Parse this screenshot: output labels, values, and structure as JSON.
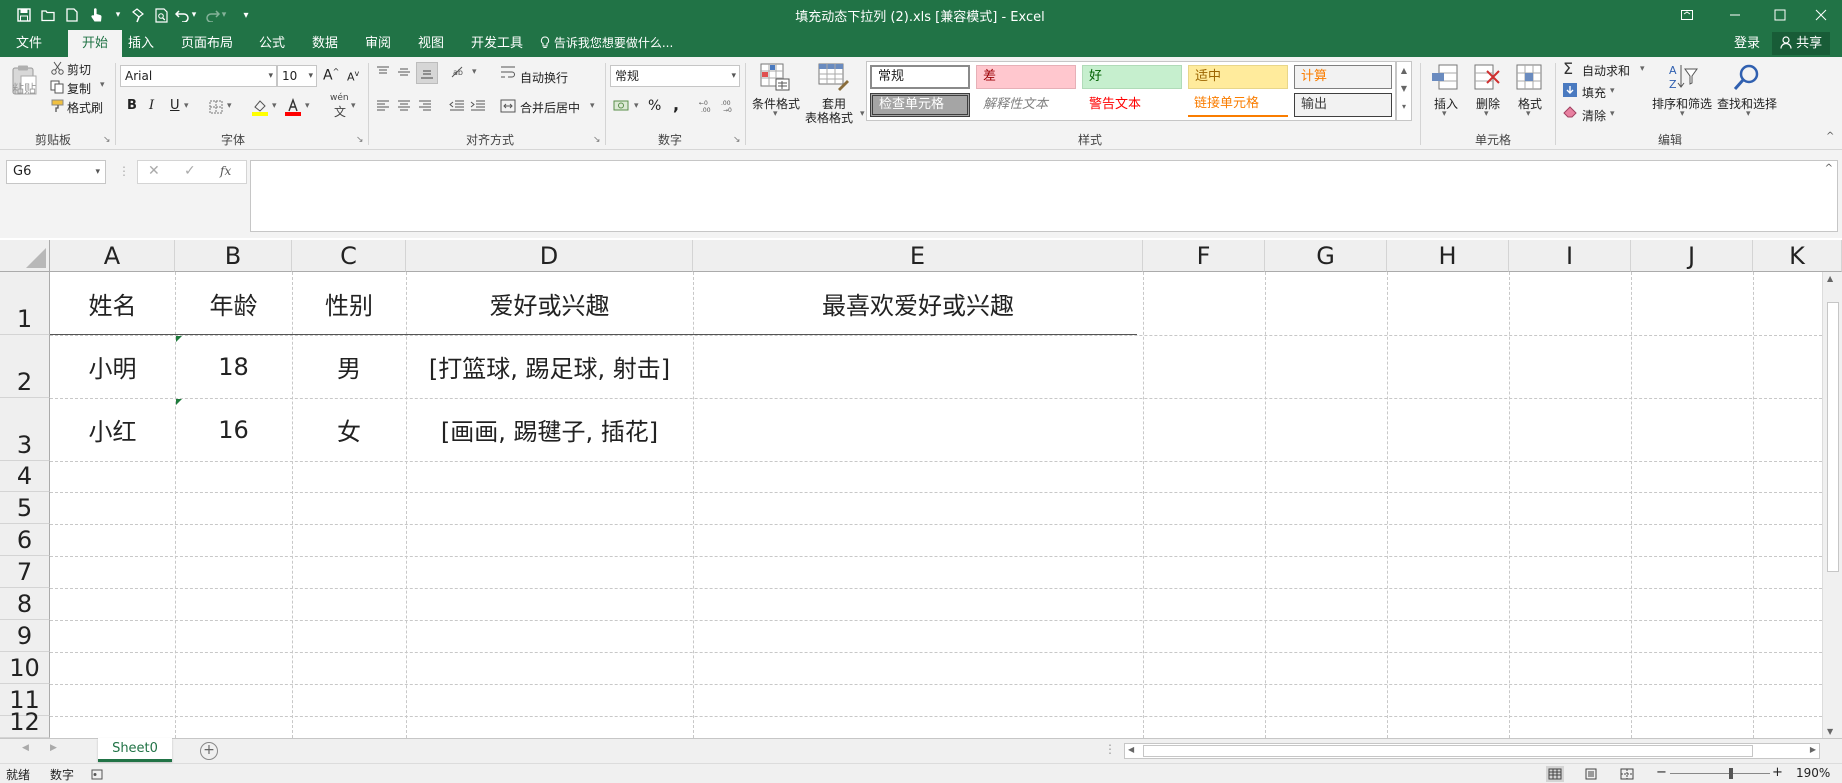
{
  "window": {
    "title": "填充动态下拉列 (2).xls  [兼容模式] - Excel",
    "minimize_icon": "minimize-icon",
    "maximize_icon": "maximize-icon",
    "close_icon": "close-icon"
  },
  "quick_access": [
    "save-icon",
    "open-icon",
    "new-icon",
    "touch-mode-icon",
    "format-painter-icon",
    "print-preview-icon",
    "undo-icon",
    "redo-icon",
    "customize-icon"
  ],
  "tabs": [
    {
      "label": "文件"
    },
    {
      "label": "开始",
      "active": true
    },
    {
      "label": "插入"
    },
    {
      "label": "页面布局"
    },
    {
      "label": "公式"
    },
    {
      "label": "数据"
    },
    {
      "label": "审阅"
    },
    {
      "label": "视图"
    },
    {
      "label": "开发工具"
    }
  ],
  "tell_me": "告诉我您想要做什么...",
  "account": {
    "login": "登录",
    "share": "共享"
  },
  "ribbon": {
    "clipboard": {
      "paste": "粘贴",
      "cut": "剪切",
      "copy": "复制",
      "format_painter": "格式刷",
      "group": "剪贴板"
    },
    "font": {
      "font_name": "Arial",
      "font_size": "10",
      "bold": "B",
      "italic": "I",
      "underline": "U",
      "grow": "A",
      "shrink": "A",
      "phonetic": "wén",
      "group": "字体",
      "fill_color": "#ffff00",
      "font_color": "#ff0000"
    },
    "alignment": {
      "wrap": "自动换行",
      "merge": "合并后居中",
      "group": "对齐方式"
    },
    "number": {
      "format": "常规",
      "percent": "%",
      "comma": ",",
      "group": "数字"
    },
    "styles": {
      "conditional": "条件格式",
      "table_format_1": "套用",
      "table_format_2": "表格格式",
      "cells": [
        {
          "label": "常规"
        },
        {
          "label": "差"
        },
        {
          "label": "好"
        },
        {
          "label": "适中"
        },
        {
          "label": "计算"
        },
        {
          "label": "检查单元格"
        },
        {
          "label": "解释性文本"
        },
        {
          "label": "警告文本"
        },
        {
          "label": "链接单元格"
        },
        {
          "label": "输出"
        }
      ],
      "group": "样式"
    },
    "cells_group": {
      "insert": "插入",
      "delete": "删除",
      "format": "格式",
      "group": "单元格"
    },
    "editing": {
      "autosum": "自动求和",
      "fill": "填充",
      "clear": "清除",
      "sort": "排序和筛选",
      "find": "查找和选择",
      "group": "编辑"
    }
  },
  "formula_bar": {
    "name_box": "G6",
    "fx": "fx",
    "content": ""
  },
  "columns": [
    "A",
    "B",
    "C",
    "D",
    "E",
    "F",
    "G",
    "H",
    "I",
    "J",
    "K"
  ],
  "rows": [
    "1",
    "2",
    "3",
    "4",
    "5",
    "6",
    "7",
    "8",
    "9",
    "10",
    "11",
    "12"
  ],
  "table": {
    "headers": [
      "姓名",
      "年龄",
      "性别",
      "爱好或兴趣",
      "最喜欢爱好或兴趣"
    ],
    "data": [
      [
        "小明",
        "18",
        "男",
        "[打篮球, 踢足球, 射击]",
        ""
      ],
      [
        "小红",
        "16",
        "女",
        "[画画, 踢毽子, 插花]",
        ""
      ]
    ]
  },
  "sheets": [
    {
      "label": "Sheet0",
      "active": true
    }
  ],
  "status": {
    "ready": "就绪",
    "mode": "数字",
    "zoom": "190%"
  }
}
